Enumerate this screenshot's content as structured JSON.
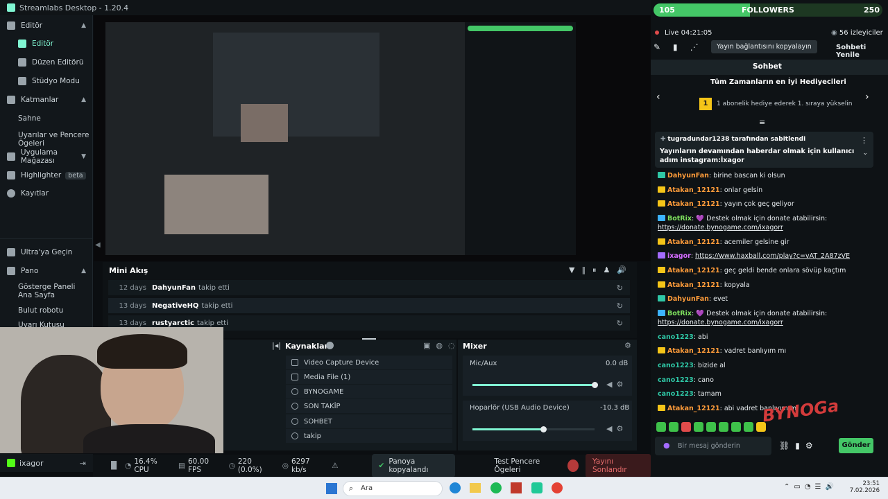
{
  "app": {
    "title": "Streamlabs Desktop - 1.20.4"
  },
  "sidebar": {
    "sections": [
      {
        "label": "Editör",
        "items": [
          "Editör",
          "Düzen Editörü",
          "Stüdyo Modu"
        ]
      },
      {
        "label": "Katmanlar",
        "items": [
          "Sahne",
          "Uyarılar ve Pencere Ögeleri"
        ]
      },
      {
        "label": "Uygulama Mağazası",
        "items": []
      }
    ],
    "highlighter": "Highlighter",
    "beta": "beta",
    "kayitlar": "Kayıtlar",
    "ultra": "Ultra'ya Geçin",
    "pano": "Pano",
    "pano_items": [
      "Gösterge Paneli Ana Sayfa",
      "Bulut robotu",
      "Uyarı Kutusu"
    ],
    "user": "ixagor"
  },
  "mini_feed": {
    "title": "Mini Akış",
    "rows": [
      {
        "days": "12 days",
        "name": "DahyunFan",
        "action": "takip etti"
      },
      {
        "days": "13 days",
        "name": "NegativeHQ",
        "action": "takip etti"
      },
      {
        "days": "13 days",
        "name": "rustyarctic",
        "action": "takip etti"
      }
    ]
  },
  "sources": {
    "title": "Kaynaklar",
    "items": [
      "Video Capture Device",
      "Media File (1)",
      "BYNOGAME",
      "SON TAKİP",
      "SOHBET",
      "takip"
    ]
  },
  "mixer": {
    "title": "Mixer",
    "channels": [
      {
        "name": "Mic/Aux",
        "db": "0.0 dB",
        "level": 1.0
      },
      {
        "name": "Hoparlör (USB Audio Device)",
        "db": "-10.3 dB",
        "level": 0.58
      }
    ]
  },
  "status": {
    "cpu": "16.4% CPU",
    "fps": "60.00 FPS",
    "dropped": "220 (0.0%)",
    "bitrate": "6297 kb/s",
    "toast": "Panoya kopyalandı",
    "test_widgets": "Test Pencere Ögeleri",
    "end_stream": "Yayını Sonlandır"
  },
  "chat": {
    "follower_goal": {
      "current": "105",
      "label": "FOLLOWERS",
      "target": "250",
      "progress": 0.42
    },
    "live": "Live",
    "time": "04:21:05",
    "viewers": "56 izleyiciler",
    "tooltip": "Yayın bağlantısını kopyalayın",
    "refresh": "Sohbeti Yenile",
    "title": "Sohbet",
    "top_gifters": "Tüm Zamanların en İyi Hediyecileri",
    "gift_rank": "1",
    "gift_text": "1 abonelik hediye ederek 1. sıraya yükselin",
    "pinned_by": "tugradundar1238 tarafından sabitlendi",
    "pinned_text": "Yayınların devamından haberdar olmak için kullanıcı adım instagram:İxagor",
    "messages": [
      {
        "user": "DahyunFan",
        "text": ": birine bascan ki olsun",
        "color": "#ff9c3a",
        "badge": "t"
      },
      {
        "user": "Atakan_12121",
        "text": ": onlar gelsin",
        "color": "#ff9c3a",
        "badge": ""
      },
      {
        "user": "Atakan_12121",
        "text": ": yayın çok geç geliyor",
        "color": "#ff9c3a",
        "badge": ""
      },
      {
        "user": "BotRix",
        "text": ": 💜 Destek olmak için donate atabilirsin:",
        "link": "https://donate.bynogame.com/ixagorr",
        "color": "#7ee05e",
        "badge": "b"
      },
      {
        "user": "Atakan_12121",
        "text": ": acemiler gelsine gir",
        "color": "#ff9c3a",
        "badge": ""
      },
      {
        "user": "ixagor",
        "text": ": ",
        "link": "https://www.haxball.com/play?c=vAT_2A87zVE",
        "color": "#d36cff",
        "badge": "p"
      },
      {
        "user": "Atakan_12121",
        "text": ": geç geldi bende onlara sövüp kaçtım",
        "color": "#ff9c3a",
        "badge": ""
      },
      {
        "user": "Atakan_12121",
        "text": ": kopyala",
        "color": "#ff9c3a",
        "badge": ""
      },
      {
        "user": "DahyunFan",
        "text": ": evet",
        "color": "#ff9c3a",
        "badge": "t"
      },
      {
        "user": "BotRix",
        "text": ": 💜 Destek olmak için donate atabilirsin:",
        "link": "https://donate.bynogame.com/ixagorr",
        "color": "#7ee05e",
        "badge": "b"
      },
      {
        "user": "cano1223",
        "text": ": abi",
        "color": "#2fc7a6",
        "badge": "none"
      },
      {
        "user": "Atakan_12121",
        "text": ": vadret banlıyım mı",
        "color": "#ff9c3a",
        "badge": ""
      },
      {
        "user": "cano1223",
        "text": ": bizide al",
        "color": "#2fc7a6",
        "badge": "none"
      },
      {
        "user": "cano1223",
        "text": ": cano",
        "color": "#2fc7a6",
        "badge": "none"
      },
      {
        "user": "cano1223",
        "text": ": tamam",
        "color": "#2fc7a6",
        "badge": "none"
      },
      {
        "user": "Atakan_12121",
        "text": ": abi vadret banlıyım mı",
        "color": "#ff9c3a",
        "badge": ""
      }
    ],
    "input_placeholder": "Bir mesaj gönderin",
    "send": "Gönder"
  },
  "taskbar": {
    "search": "Ara",
    "time": "23:51",
    "date": "7.02.2026"
  },
  "colors": {
    "accent": "#80f5d2",
    "danger": "#e04b4b",
    "goal_green": "#44c767"
  }
}
